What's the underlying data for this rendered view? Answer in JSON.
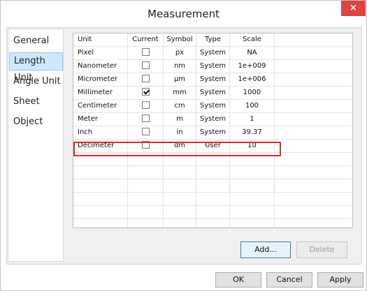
{
  "window": {
    "title": "Measurement",
    "close_glyph": "×"
  },
  "nav": {
    "items": [
      {
        "label": "General",
        "selected": false
      },
      {
        "label": "Length Unit",
        "selected": true
      },
      {
        "label": "Angle Unit",
        "selected": false
      },
      {
        "label": "Sheet",
        "selected": false
      },
      {
        "label": "Object",
        "selected": false
      }
    ]
  },
  "table": {
    "columns": [
      "Unit",
      "Current",
      "Symbol",
      "Type",
      "Scale"
    ],
    "rows": [
      {
        "unit": "Pixel",
        "current": false,
        "symbol": "px",
        "type": "System",
        "scale": "NA"
      },
      {
        "unit": "Nanometer",
        "current": false,
        "symbol": "nm",
        "type": "System",
        "scale": "1e+009"
      },
      {
        "unit": "Micrometer",
        "current": false,
        "symbol": "µm",
        "type": "System",
        "scale": "1e+006"
      },
      {
        "unit": "Millimeter",
        "current": true,
        "symbol": "mm",
        "type": "System",
        "scale": "1000"
      },
      {
        "unit": "Centimeter",
        "current": false,
        "symbol": "cm",
        "type": "System",
        "scale": "100"
      },
      {
        "unit": "Meter",
        "current": false,
        "symbol": "m",
        "type": "System",
        "scale": "1"
      },
      {
        "unit": "Inch",
        "current": false,
        "symbol": "in",
        "type": "System",
        "scale": "39.37"
      },
      {
        "unit": "Decimeter",
        "current": false,
        "symbol": "dm",
        "type": "User",
        "scale": "10"
      }
    ],
    "empty_rows": 6
  },
  "actions": {
    "add_label": "Add...",
    "delete_label": "Delete"
  },
  "footer": {
    "ok_label": "OK",
    "cancel_label": "Cancel",
    "apply_label": "Apply"
  },
  "colors": {
    "highlight": "#e02b2b",
    "close": "#e04343",
    "selected_nav": "#cde8fb"
  }
}
